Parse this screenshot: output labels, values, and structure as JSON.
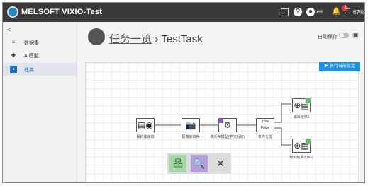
{
  "app": {
    "title": "MELSOFT VIXIO-Test"
  },
  "topbar": {
    "user_name": "mee",
    "notification_count": "2",
    "battery": "67%",
    "icons": [
      "book-icon",
      "help-icon",
      "user-icon",
      "bell-icon",
      "menu-icon"
    ]
  },
  "sidebar": {
    "collapse_glyph": "<",
    "items": [
      {
        "label": "数据集",
        "icon": "database-icon",
        "active": false
      },
      {
        "label": "AI模型",
        "icon": "layers-icon",
        "active": false
      },
      {
        "label": "任务",
        "icon": "task-icon",
        "active": true
      }
    ]
  },
  "breadcrumb": {
    "parent": "任务一览",
    "separator": "›",
    "current": "TestTask"
  },
  "controls": {
    "autosave_label": "自动保存",
    "autosave_on": false
  },
  "canvas_button": {
    "label": "执行当前设定"
  },
  "flow": {
    "nodes": [
      {
        "id": "n1",
        "label": "相机和读取",
        "icon": "camera-input-icon"
      },
      {
        "id": "n2",
        "label": "图像的取得",
        "icon": "camera-icon"
      },
      {
        "id": "n3",
        "label": "执行AI模型(学习后的)",
        "icon": "gear-icon"
      },
      {
        "id": "n4",
        "label": "条件分支",
        "icon": "branch-icon",
        "branches": [
          "True",
          "False"
        ]
      },
      {
        "id": "n5",
        "label": "输出结果1",
        "icon": "output-icon"
      },
      {
        "id": "n6",
        "label": "输出结果2(NG)",
        "icon": "output-icon"
      }
    ]
  },
  "toolbar": {
    "tools": [
      {
        "name": "hierarchy-tool-icon",
        "color": "#3e8e41",
        "accent": "#a5d6a7"
      },
      {
        "name": "inspect-tool-icon",
        "color": "#5c6bc0",
        "accent": "#b39ddb"
      },
      {
        "name": "settings-tool-icon",
        "color": "#333333",
        "accent": "#dcdcdc"
      }
    ]
  },
  "colors": {
    "topbar": "#3a3a3a",
    "accent": "#1a73c8",
    "button": "#1e90e0"
  }
}
